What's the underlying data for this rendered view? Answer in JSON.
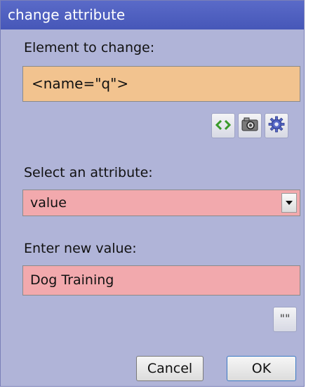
{
  "dialog": {
    "title": "change attribute",
    "element_label": "Element to change:",
    "element_value": "<name=\"q\">",
    "toolbar_icons": [
      "code-brackets-icon",
      "camera-icon",
      "gear-icon"
    ],
    "attribute_label": "Select an attribute:",
    "attribute_selected": "value",
    "new_value_label": "Enter new value:",
    "new_value": "Dog Training",
    "quote_button_label": "\"\"",
    "cancel_label": "Cancel",
    "ok_label": "OK"
  },
  "colors": {
    "dialog_bg": "#b0b4d8",
    "titlebar": "#4a5bbd",
    "element_field": "#f2c38f",
    "attribute_field": "#f2a9ad"
  }
}
